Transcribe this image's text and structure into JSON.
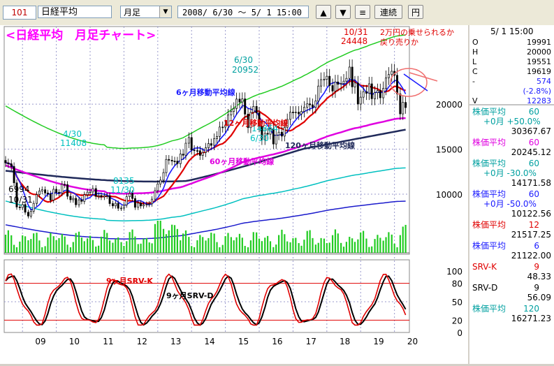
{
  "toolbar": {
    "code": "101",
    "name": "日経平均",
    "period": "月足",
    "range": "2008/ 6/30 ～  5/ 1 15:00",
    "btn_up": "▲",
    "btn_down": "▼",
    "btn_list": "≡",
    "btn_continuous": "連続",
    "btn_yen": "円"
  },
  "chart_title": "<日経平均　月足チャート>",
  "chart_data": [
    {
      "type": "candlestick",
      "title": "<日経平均　月足チャート>",
      "x_ticks": [
        "09",
        "10",
        "11",
        "12",
        "13",
        "14",
        "15",
        "16",
        "17",
        "18",
        "19",
        "20"
      ],
      "y_ticks": [
        10000,
        15000,
        20000
      ],
      "ylim": [
        5500,
        28000
      ],
      "close_series": [
        [
          2008.5,
          13480
        ],
        [
          2008.58,
          13376
        ],
        [
          2008.67,
          13072
        ],
        [
          2008.75,
          11259
        ],
        [
          2008.83,
          8576
        ],
        [
          2008.92,
          8512
        ],
        [
          2009.0,
          8859
        ],
        [
          2009.08,
          7994
        ],
        [
          2009.17,
          7568
        ],
        [
          2009.25,
          8109
        ],
        [
          2009.33,
          8977
        ],
        [
          2009.42,
          9958
        ],
        [
          2009.5,
          10356
        ],
        [
          2009.58,
          10492
        ],
        [
          2009.67,
          10133
        ],
        [
          2009.75,
          10034
        ],
        [
          2009.83,
          9345
        ],
        [
          2009.92,
          10546
        ],
        [
          2010.0,
          10198
        ],
        [
          2010.08,
          10126
        ],
        [
          2010.17,
          11089
        ],
        [
          2010.25,
          11057
        ],
        [
          2010.33,
          9768
        ],
        [
          2010.42,
          9382
        ],
        [
          2010.5,
          9537
        ],
        [
          2010.58,
          8824
        ],
        [
          2010.67,
          9369
        ],
        [
          2010.75,
          9202
        ],
        [
          2010.83,
          9937
        ],
        [
          2010.92,
          10228
        ],
        [
          2011.0,
          10237
        ],
        [
          2011.08,
          10624
        ],
        [
          2011.17,
          9755
        ],
        [
          2011.25,
          9849
        ],
        [
          2011.33,
          9693
        ],
        [
          2011.42,
          9816
        ],
        [
          2011.5,
          9833
        ],
        [
          2011.58,
          8955
        ],
        [
          2011.67,
          8700
        ],
        [
          2011.75,
          8988
        ],
        [
          2011.83,
          8434
        ],
        [
          2011.92,
          8455
        ],
        [
          2012.0,
          8802
        ],
        [
          2012.08,
          9723
        ],
        [
          2012.17,
          10083
        ],
        [
          2012.25,
          9520
        ],
        [
          2012.33,
          8542
        ],
        [
          2012.42,
          9006
        ],
        [
          2012.5,
          8695
        ],
        [
          2012.58,
          8839
        ],
        [
          2012.67,
          8870
        ],
        [
          2012.75,
          8928
        ],
        [
          2012.83,
          9446
        ],
        [
          2012.92,
          10395
        ],
        [
          2013.0,
          11138
        ],
        [
          2013.08,
          11559
        ],
        [
          2013.17,
          12397
        ],
        [
          2013.25,
          13860
        ],
        [
          2013.33,
          13774
        ],
        [
          2013.42,
          13677
        ],
        [
          2013.5,
          13668
        ],
        [
          2013.58,
          13388
        ],
        [
          2013.67,
          14455
        ],
        [
          2013.75,
          14327
        ],
        [
          2013.83,
          15661
        ],
        [
          2013.92,
          16291
        ],
        [
          2014.0,
          14914
        ],
        [
          2014.08,
          14841
        ],
        [
          2014.17,
          14827
        ],
        [
          2014.25,
          14304
        ],
        [
          2014.33,
          14632
        ],
        [
          2014.42,
          15162
        ],
        [
          2014.5,
          15620
        ],
        [
          2014.58,
          15424
        ],
        [
          2014.67,
          16173
        ],
        [
          2014.75,
          16413
        ],
        [
          2014.83,
          17459
        ],
        [
          2014.92,
          17450
        ],
        [
          2015.0,
          17674
        ],
        [
          2015.08,
          18797
        ],
        [
          2015.17,
          19206
        ],
        [
          2015.25,
          19520
        ],
        [
          2015.33,
          20563
        ],
        [
          2015.42,
          20235
        ],
        [
          2015.5,
          20585
        ],
        [
          2015.58,
          18890
        ],
        [
          2015.67,
          17388
        ],
        [
          2015.75,
          19083
        ],
        [
          2015.83,
          19747
        ],
        [
          2015.92,
          19033
        ],
        [
          2016.0,
          17518
        ],
        [
          2016.08,
          16026
        ],
        [
          2016.17,
          16758
        ],
        [
          2016.25,
          16666
        ],
        [
          2016.33,
          17234
        ],
        [
          2016.42,
          15575
        ],
        [
          2016.5,
          16569
        ],
        [
          2016.58,
          16887
        ],
        [
          2016.67,
          16449
        ],
        [
          2016.75,
          17425
        ],
        [
          2016.83,
          18308
        ],
        [
          2016.92,
          19114
        ],
        [
          2017.0,
          19041
        ],
        [
          2017.08,
          19118
        ],
        [
          2017.17,
          18909
        ],
        [
          2017.25,
          19196
        ],
        [
          2017.33,
          19650
        ],
        [
          2017.42,
          20033
        ],
        [
          2017.5,
          19925
        ],
        [
          2017.58,
          19646
        ],
        [
          2017.67,
          20356
        ],
        [
          2017.75,
          22011
        ],
        [
          2017.83,
          22724
        ],
        [
          2017.92,
          22764
        ],
        [
          2018.0,
          23098
        ],
        [
          2018.08,
          22068
        ],
        [
          2018.17,
          21454
        ],
        [
          2018.25,
          22467
        ],
        [
          2018.33,
          22201
        ],
        [
          2018.42,
          22304
        ],
        [
          2018.5,
          22553
        ],
        [
          2018.58,
          22865
        ],
        [
          2018.67,
          24120
        ],
        [
          2018.75,
          21920
        ],
        [
          2018.83,
          22351
        ],
        [
          2018.92,
          20014
        ],
        [
          2019.0,
          20773
        ],
        [
          2019.08,
          21385
        ],
        [
          2019.17,
          21205
        ],
        [
          2019.25,
          22258
        ],
        [
          2019.33,
          20601
        ],
        [
          2019.42,
          21275
        ],
        [
          2019.5,
          21521
        ],
        [
          2019.58,
          20704
        ],
        [
          2019.67,
          21755
        ],
        [
          2019.75,
          22927
        ],
        [
          2019.83,
          23293
        ],
        [
          2019.92,
          23656
        ],
        [
          2020.0,
          23205
        ],
        [
          2020.08,
          21142
        ],
        [
          2020.17,
          18917
        ],
        [
          2020.25,
          20193
        ],
        [
          2020.33,
          19619
        ]
      ],
      "ma_lines": [
        {
          "name": "6ヶ月移動平均線",
          "color": "#1a1aff"
        },
        {
          "name": "12ヶ月移動平均線",
          "color": "#e00000"
        },
        {
          "name": "60ヶ月移動平均線",
          "color": "#e000e0"
        },
        {
          "name": "120ヶ月移動平均線",
          "color": "#202a5a"
        }
      ],
      "annotations": [
        {
          "text": "10/31",
          "sub": "24448",
          "color": "#e00000"
        },
        {
          "text": "6/30",
          "sub": "20952",
          "color": "#00a0a0"
        },
        {
          "text": "2万円の乗せられるか",
          "sub": "戻り売りか",
          "color": "#e00000"
        },
        {
          "text": "4/30",
          "sub": "11408",
          "color": "#00c0c0"
        },
        {
          "text": "8135",
          "sub": "11/30",
          "color": "#00c0c0"
        },
        {
          "text": "6994",
          "sub": "10/31",
          "color": "#000000"
        },
        {
          "text": "14864",
          "sub": "6/30",
          "color": "#00c0c0"
        }
      ]
    },
    {
      "type": "bar",
      "title": "",
      "series": [
        {
          "name": "volume",
          "color": "#00c000"
        }
      ]
    },
    {
      "type": "line",
      "title": "",
      "y_ticks": [
        0,
        20,
        50,
        80,
        100
      ],
      "ylim": [
        0,
        100
      ],
      "series": [
        {
          "name": "9ヶ月SRV-K",
          "color": "#e00000"
        },
        {
          "name": "9ヶ月SRV-D",
          "color": "#000000"
        }
      ]
    }
  ],
  "side_panel": {
    "header_date": "5/ 1 15:00",
    "ohlc": [
      {
        "label": "O",
        "value": "19991"
      },
      {
        "label": "H",
        "value": "20000"
      },
      {
        "label": "L",
        "value": "19551"
      },
      {
        "label": "C",
        "value": "19619"
      },
      {
        "label": "-",
        "value": "574"
      },
      {
        "label": "",
        "value": "(-2.8%)"
      },
      {
        "label": "V",
        "value": "12283"
      }
    ],
    "indicators": [
      {
        "name": "株価平均",
        "period": "60",
        "sub": "+0月 +50.0%",
        "value": "30367.67",
        "color": "#00a0a0"
      },
      {
        "name": "株価平均",
        "period": "60",
        "sub": "",
        "value": "20245.12",
        "color": "#e000e0"
      },
      {
        "name": "株価平均",
        "period": "60",
        "sub": "+0月 -30.0%",
        "value": "14171.58",
        "color": "#00a0a0"
      },
      {
        "name": "株価平均",
        "period": "60",
        "sub": "+0月 -50.0%",
        "value": "10122.56",
        "color": "#1a1aff"
      },
      {
        "name": "株価平均",
        "period": "12",
        "sub": "",
        "value": "21517.25",
        "color": "#e00000"
      },
      {
        "name": "株価平均",
        "period": "6",
        "sub": "",
        "value": "21122.00",
        "color": "#1a1aff"
      },
      {
        "name": "SRV-K",
        "period": "9",
        "sub": "",
        "value": "48.33",
        "color": "#e00000"
      },
      {
        "name": "SRV-D",
        "period": "9",
        "sub": "",
        "value": "56.09",
        "color": "#000000"
      },
      {
        "name": "株価平均",
        "period": "120",
        "sub": "",
        "value": "16271.23",
        "color": "#00a0a0"
      }
    ]
  }
}
